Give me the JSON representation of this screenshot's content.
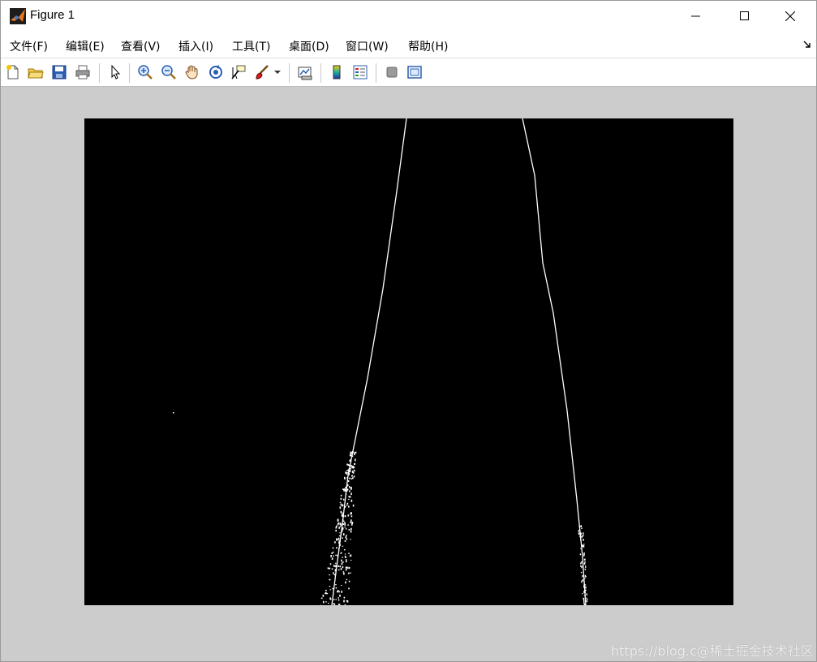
{
  "window": {
    "title": "Figure 1",
    "controls": [
      "minimize",
      "maximize",
      "close"
    ]
  },
  "menu": {
    "items": [
      {
        "label": "文件(F)"
      },
      {
        "label": "编辑(E)"
      },
      {
        "label": "查看(V)"
      },
      {
        "label": "插入(I)"
      },
      {
        "label": "工具(T)"
      },
      {
        "label": "桌面(D)"
      },
      {
        "label": "窗口(W)"
      },
      {
        "label": "帮助(H)"
      }
    ]
  },
  "toolbar": {
    "buttons": [
      {
        "icon": "new-figure-icon"
      },
      {
        "icon": "open-file-icon"
      },
      {
        "icon": "save-icon"
      },
      {
        "icon": "print-icon"
      },
      {
        "icon": "edit-plot-arrow-icon"
      },
      {
        "icon": "zoom-in-icon"
      },
      {
        "icon": "zoom-out-icon"
      },
      {
        "icon": "pan-hand-icon"
      },
      {
        "icon": "rotate-3d-icon"
      },
      {
        "icon": "data-cursor-icon"
      },
      {
        "icon": "brush-icon"
      },
      {
        "icon": "link-plot-icon"
      },
      {
        "icon": "colorbar-icon"
      },
      {
        "icon": "legend-icon"
      },
      {
        "icon": "hide-plot-tools-icon"
      },
      {
        "icon": "show-plot-tools-icon"
      }
    ]
  },
  "figure": {
    "background_color": "#cccccc",
    "image_background": "#000000",
    "edge_color": "#ffffff",
    "description": ""
  },
  "watermark": "https://blog.c@稀土掘金技术社区",
  "colors": {
    "matlab_orange": "#e8741a",
    "toolbar_blue": "#2060c0"
  }
}
